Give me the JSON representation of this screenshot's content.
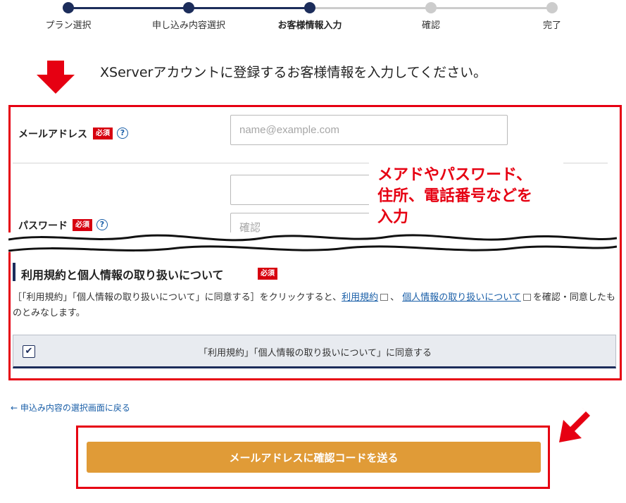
{
  "stepper": {
    "steps": [
      {
        "label": "プラン選択"
      },
      {
        "label": "申し込み内容選択"
      },
      {
        "label": "お客様情報入力"
      },
      {
        "label": "確認"
      },
      {
        "label": "完了"
      }
    ],
    "current_step": 3,
    "active_color": "#1c2d5b",
    "inactive_color": "#cccccc"
  },
  "instruction": "XServerアカウントに登録するお客様情報を入力してください。",
  "required_badge": "必須",
  "help_symbol": "?",
  "email": {
    "label": "メールアドレス",
    "placeholder": "name@example.com"
  },
  "password": {
    "label": "パスワード",
    "confirm_placeholder": "確認"
  },
  "annotation": {
    "lines": [
      "メアドやパスワード、",
      "住所、電話番号などを",
      "入力"
    ]
  },
  "terms": {
    "title": "利用規約と個人情報の取り扱いについて",
    "text_before": "［「利用規約」「個人情報の取り扱いについて」に同意する］をクリックすると、",
    "link_terms": "利用規約",
    "separator": "、",
    "link_privacy": "個人情報の取り扱いについて",
    "text_after": "を確認・同意したものとみなします。",
    "agree_label": "「利用規約」「個人情報の取り扱いについて」に同意する",
    "agree_checked": true,
    "check_symbol": "✔"
  },
  "back_link": "← 申込み内容の選択画面に戻る",
  "submit_button": "メールアドレスに確認コードを送る",
  "colors": {
    "accent_red": "#e60012",
    "navy": "#1c2d5b",
    "button": "#e09b37",
    "link": "#1a5fa8"
  },
  "icons": [
    "down-arrow-icon",
    "diagonal-arrow-icon",
    "help-icon",
    "external-link-icon",
    "checkmark-icon"
  ]
}
